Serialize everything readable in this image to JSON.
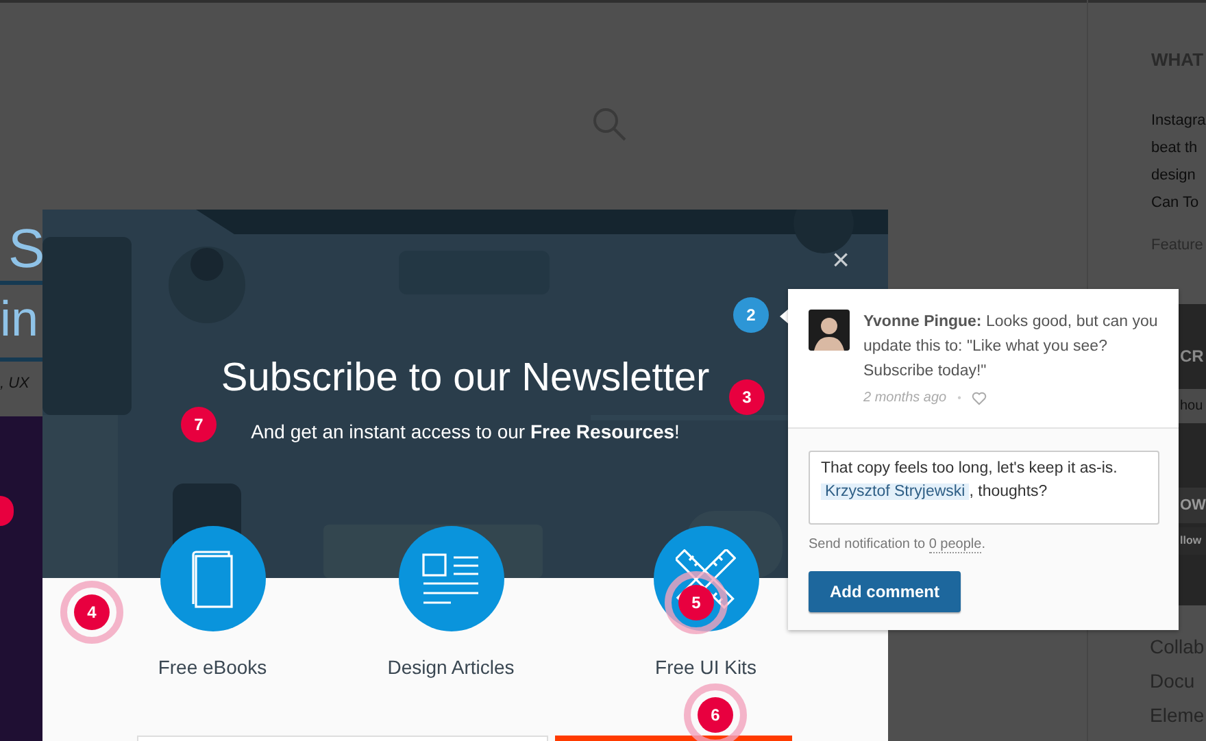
{
  "page": {
    "heading_fragments": [
      "S",
      "in"
    ],
    "byline": ", UX"
  },
  "sidebar": {
    "heading": "WHAT",
    "lines": [
      "Instagra",
      "beat th",
      "design",
      "Can To"
    ],
    "featured": "Feature",
    "panel": {
      "heading": "CR",
      "field_value": "hou",
      "button": "OW",
      "button_2": "llow"
    },
    "links": [
      "Collab",
      "Docu",
      "Eleme"
    ]
  },
  "modal": {
    "close": "×",
    "title": "Subscribe to our Newsletter",
    "subtitle": "And get an instant access to our **Free Resources**!",
    "features": [
      {
        "kind": "book",
        "label": "Free eBooks"
      },
      {
        "kind": "article",
        "label": "Design Articles"
      },
      {
        "kind": "tools",
        "label": "Free UI Kits"
      }
    ]
  },
  "comment": {
    "text": "**Yvonne Pingue:** Looks good, but can you update this to: \"Like what you see? Subscribe today!\"",
    "time": "2 months ago",
    "separator": "•",
    "reply": {
      "before": "That copy feels too long, let's keep it as-is.",
      "mention": "Krzysztof Stryjewski",
      "after": ", thoughts?"
    },
    "notify": {
      "before": "Send notification to",
      "link": "0 people",
      "after": "."
    },
    "button": "Add comment"
  },
  "pins": [
    {
      "label": "2",
      "color": "#2d96d6",
      "ring": false
    },
    {
      "label": "3",
      "color": "#e8003f",
      "ring": false
    },
    {
      "label": "7",
      "color": "#e8003f",
      "ring": false
    },
    {
      "label": "4",
      "color": "#e8003f",
      "ring": true
    },
    {
      "label": "5",
      "color": "#e8003f",
      "ring": true
    },
    {
      "label": "6",
      "color": "#e8003f",
      "ring": true
    }
  ]
}
